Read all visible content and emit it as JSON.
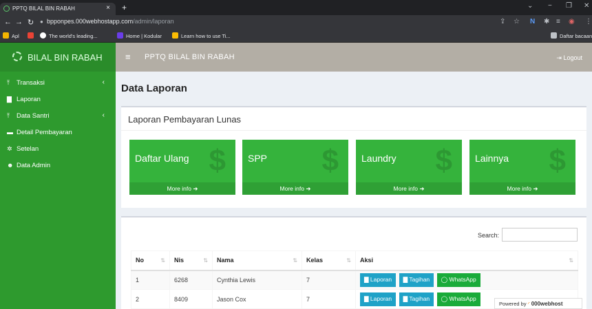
{
  "browser": {
    "tab_title": "PPTQ BILAL BIN RABAH",
    "tab_close": "×",
    "new_tab": "+",
    "url_host": "bpponpes.000webhostapp.com",
    "url_path": "/admin/laporan",
    "bookmarks": [
      {
        "label": "Apl",
        "color": "#f4b400"
      },
      {
        "label": "",
        "color": "#ea4335"
      },
      {
        "label": "The world's leading...",
        "color": "#ffffff"
      },
      {
        "label": "Home | Kodular",
        "color": "#6a3de8"
      },
      {
        "label": "Learn how to use Ti...",
        "color": "#fbbc04"
      },
      {
        "label": "Daftar bacaan",
        "color": "#bdc1c6"
      }
    ]
  },
  "sidebar": {
    "brand": "BILAL BIN RABAH",
    "items": [
      {
        "label": "Transaksi",
        "icon": "upload-icon",
        "chevron": "‹"
      },
      {
        "label": "Laporan",
        "icon": "file-icon",
        "chevron": ""
      },
      {
        "label": "Data Santri",
        "icon": "upload-icon",
        "chevron": "‹"
      },
      {
        "label": "Detail Pembayaran",
        "icon": "card-icon",
        "chevron": ""
      },
      {
        "label": "Setelan",
        "icon": "gears-icon",
        "chevron": ""
      },
      {
        "label": "Data Admin",
        "icon": "users-icon",
        "chevron": ""
      }
    ]
  },
  "topbar": {
    "title": "PPTQ BILAL BIN RABAH",
    "logout": "Logout"
  },
  "page": {
    "title": "Data Laporan",
    "box_title": "Laporan Pembayaran Lunas",
    "stats": [
      {
        "label": "Daftar Ulang",
        "more": "More info"
      },
      {
        "label": "SPP",
        "more": "More info"
      },
      {
        "label": "Laundry",
        "more": "More info"
      },
      {
        "label": "Lainnya",
        "more": "More info"
      }
    ],
    "colors": {
      "stat_green": "#35b33c",
      "btn_blue": "#1fa2c7",
      "btn_green": "#1aab3a",
      "sidebar": "#2e9a2e"
    }
  },
  "table": {
    "search_label": "Search:",
    "columns": [
      "No",
      "Nis",
      "Nama",
      "Kelas",
      "Aksi"
    ],
    "rows": [
      {
        "no": "1",
        "nis": "6268",
        "nama": "Cynthia Lewis",
        "kelas": "7"
      },
      {
        "no": "2",
        "nis": "8409",
        "nama": "Jason Cox",
        "kelas": "7"
      }
    ],
    "actions": {
      "laporan": "Laporan",
      "tagihan": "Tagihan",
      "whatsapp": "WhatsApp"
    }
  },
  "footer": {
    "powered_by": "Powered by",
    "brand": "000webhost"
  }
}
